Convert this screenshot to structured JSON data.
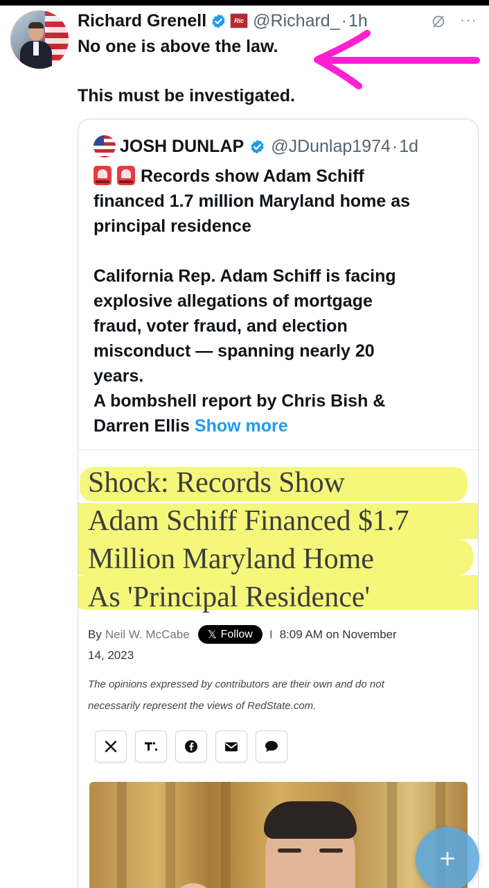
{
  "tweet": {
    "author_name": "Richard Grenell",
    "handle": "@Richard_",
    "separator": "·",
    "time": "1h",
    "affiliate_badge_label": "Ric",
    "lines": [
      "No one is above the law.",
      "This must be investigated."
    ]
  },
  "quote": {
    "author_name": "JOSH DUNLAP",
    "handle": "@JDunlap1974",
    "separator": "·",
    "time": "1d",
    "lines": [
      "Records show Adam Schiff",
      "financed 1.7 million Maryland home as",
      "principal residence",
      "California Rep. Adam Schiff is facing",
      "explosive allegations of mortgage",
      "fraud, voter fraud, and election",
      "misconduct — spanning nearly 20",
      "years.",
      "A bombshell report by Chris Bish &",
      "Darren Ellis"
    ],
    "show_more": "Show more"
  },
  "article": {
    "headline_lines": [
      "Shock: Records Show",
      "Adam Schiff Financed $1.7",
      "Million Maryland Home",
      "As 'Principal Residence'"
    ],
    "by_label": "By",
    "author": "Neil W. McCabe",
    "follow_label": "Follow",
    "separator": "I",
    "dateline_a": "8:09 AM on November",
    "dateline_b": "14, 2023",
    "disclaimer_lines": [
      "The opinions expressed by contributors are their own and do not",
      "necessarily represent the views of RedState.com."
    ],
    "share_buttons": [
      "x-icon",
      "truth-social-icon",
      "facebook-icon",
      "email-icon",
      "comment-icon"
    ]
  },
  "colors": {
    "annotation_arrow": "#ff1fd2",
    "highlight": "#f4f77a",
    "verified": "#1d9bf0",
    "fab": "#5aa8e0"
  },
  "compose_button_label": "+"
}
